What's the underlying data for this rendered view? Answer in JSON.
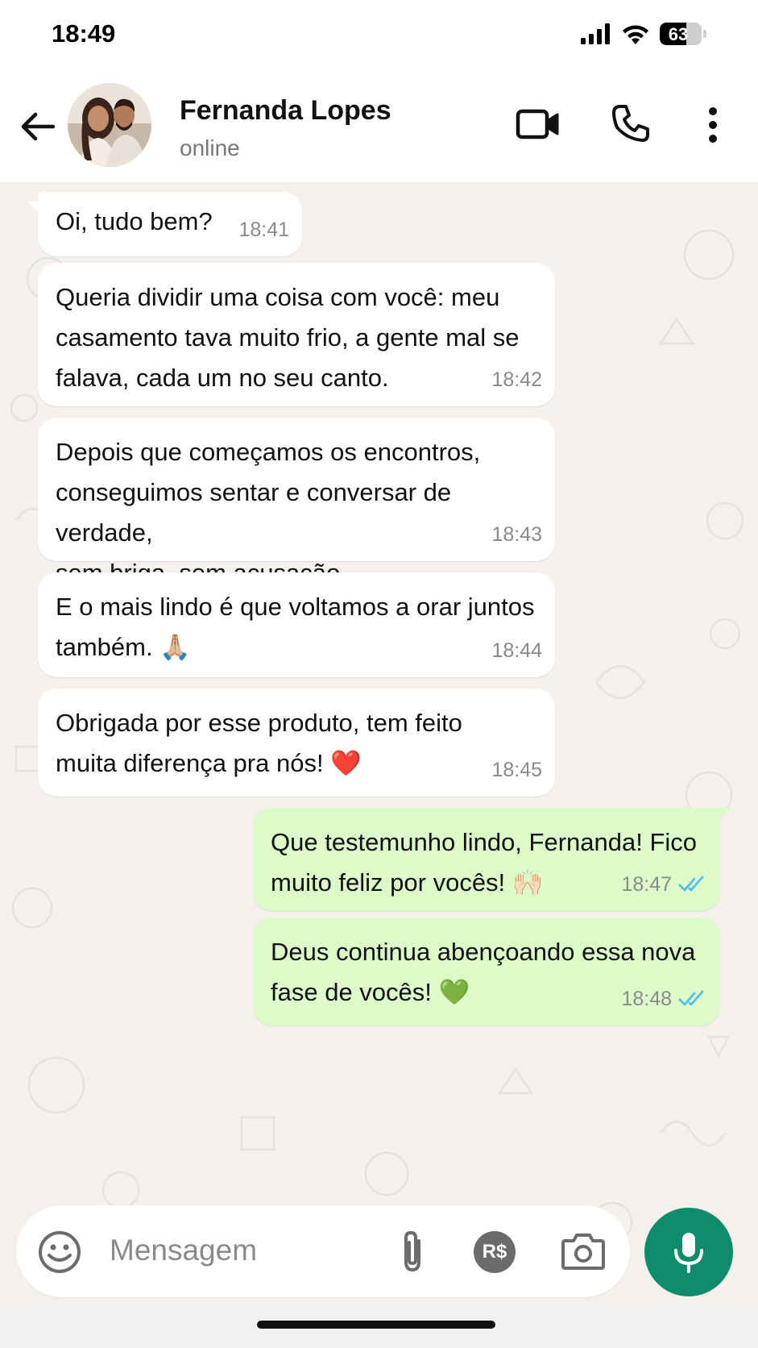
{
  "status_bar": {
    "time": "18:49",
    "battery_level": "63",
    "battery_fraction": 0.63
  },
  "header": {
    "contact_name": "Fernanda Lopes",
    "contact_status": "online",
    "icons": [
      "back-arrow-icon",
      "video-call-icon",
      "phone-icon",
      "more-vertical-icon"
    ]
  },
  "messages": [
    {
      "direction": "in",
      "text": "Oi, tudo bem?",
      "time": "18:41"
    },
    {
      "direction": "in",
      "text": "Queria dividir uma coisa com você: meu\ncasamento tava muito frio, a gente mal se\nfalava, cada um no seu canto.",
      "time": "18:42"
    },
    {
      "direction": "in",
      "text": "Depois que começamos os encontros,\nconseguimos sentar e conversar de verdade,\nsem briga, sem acusação.",
      "time": "18:43"
    },
    {
      "direction": "in",
      "text": "E o mais lindo é que voltamos a orar juntos\ntambém. 🙏🏼",
      "time": "18:44"
    },
    {
      "direction": "in",
      "text": "Obrigada por esse produto, tem feito\nmuita diferença pra nós! ❤️",
      "time": "18:45"
    },
    {
      "direction": "out",
      "text": "Que testemunho lindo, Fernanda! Fico\nmuito feliz por vocês! 🙌🏻",
      "time": "18:47",
      "status": "read"
    },
    {
      "direction": "out",
      "text": "Deus continua abençoando essa nova\nfase de vocês! 💚",
      "time": "18:48",
      "status": "read"
    }
  ],
  "input_bar": {
    "placeholder": "Mensagem",
    "payment_label": "R$"
  },
  "colors": {
    "outgoing_bubble": "#dcfbc9",
    "incoming_bubble": "#ffffff",
    "wallpaper": "#f4f1ec",
    "accent_green": "#0e8c6b",
    "read_ticks": "#53bdeb"
  }
}
